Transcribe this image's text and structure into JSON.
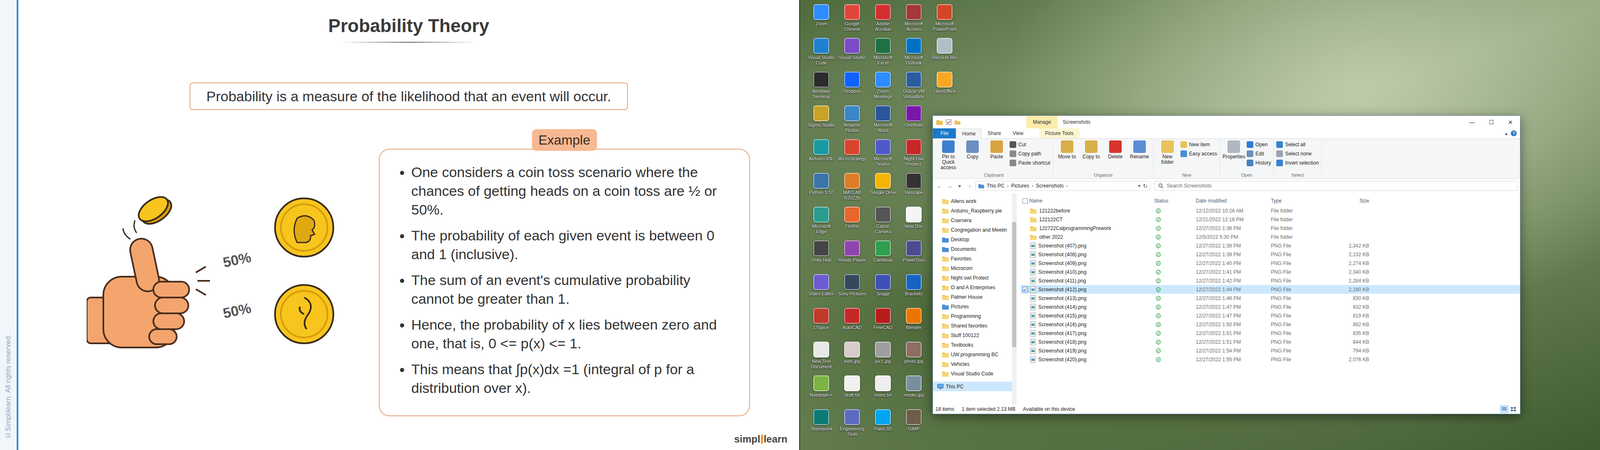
{
  "slide": {
    "title": "Probability Theory",
    "definition": "Probability is a measure of the likelihood that an event will occur.",
    "badge": "Example",
    "bullets": [
      "One considers a coin toss scenario where the chances of getting heads on a coin toss are ½ or 50%.",
      "The probability of each given event is between 0 and 1 (inclusive).",
      "The sum of an event's cumulative probability cannot be greater than 1.",
      "Hence, the probability of x lies between zero and one, that is, 0 <= p(x) <= 1.",
      "This means that ∫p(x)dx =1 (integral of p for a distribution over x)."
    ],
    "illustration_labels": [
      "50%",
      "50%"
    ],
    "copyright": "©Simplilearn. All rights reserved.",
    "logo": {
      "left": "simpl",
      "right": "learn"
    }
  },
  "desktop": {
    "icons": [
      {
        "label": "Zoom",
        "color": "#2d8cff"
      },
      {
        "label": "Visual Studio Code",
        "color": "#1f7fd0"
      },
      {
        "label": "Windows Terminal",
        "color": "#2b2b2b"
      },
      {
        "label": "Sigma Studio",
        "color": "#c9a227"
      },
      {
        "label": "Arduino IDE",
        "color": "#1a9aa0"
      },
      {
        "label": "Python 3.10",
        "color": "#3b74a8"
      },
      {
        "label": "Microsoft Edge",
        "color": "#2a9d8f"
      },
      {
        "label": "Unity Hub",
        "color": "#444444"
      },
      {
        "label": "Video Editor",
        "color": "#6b5bd1"
      },
      {
        "label": "LTspice",
        "color": "#c0392b"
      },
      {
        "label": "New Text Document",
        "color": "#e8e8e8"
      },
      {
        "label": "Notepad++",
        "color": "#7cb342"
      },
      {
        "label": "Sharepoint",
        "color": "#0b7a75"
      },
      {
        "label": "Google Chrome",
        "color": "#e0463a"
      },
      {
        "label": "Visual Studio",
        "color": "#7b4bc4"
      },
      {
        "label": "Dropbox",
        "color": "#0f62fe"
      },
      {
        "label": "Amazon Photos",
        "color": "#3a86c8"
      },
      {
        "label": "MicroStrategy",
        "color": "#d9442e"
      },
      {
        "label": "MATLAB R2022b",
        "color": "#e07b27"
      },
      {
        "label": "Firefox",
        "color": "#e8662b"
      },
      {
        "label": "Ready Player",
        "color": "#8e44ad"
      },
      {
        "label": "Sony Pictures",
        "color": "#34495e"
      },
      {
        "label": "AutoCAD",
        "color": "#c62828"
      },
      {
        "label": "todo.jpg",
        "color": "#d7ccc8"
      },
      {
        "label": "draft.txt",
        "color": "#f1f1f1"
      },
      {
        "label": "Engineering Tools",
        "color": "#5c6bc0"
      },
      {
        "label": "Adobe Acrobat",
        "color": "#d32f2f"
      },
      {
        "label": "Microsoft Excel",
        "color": "#1e7145"
      },
      {
        "label": "Zoom Meetings",
        "color": "#2d8cff"
      },
      {
        "label": "Microsoft Word",
        "color": "#2b579a"
      },
      {
        "label": "Microsoft Teams",
        "color": "#5059c9"
      },
      {
        "label": "Google Drive",
        "color": "#f4b400"
      },
      {
        "label": "Canon Camera",
        "color": "#555555"
      },
      {
        "label": "Camtasia",
        "color": "#2e9e4f"
      },
      {
        "label": "Snagit",
        "color": "#3f51b5"
      },
      {
        "label": "FreeCAD",
        "color": "#b71c1c"
      },
      {
        "label": "pic1.jpg",
        "color": "#9e9e9e"
      },
      {
        "label": "notes.txt",
        "color": "#eeeeee"
      },
      {
        "label": "Paint 3D",
        "color": "#00a4ef"
      },
      {
        "label": "Microsoft Access",
        "color": "#a4373a"
      },
      {
        "label": "Microsoft Outlook",
        "color": "#0072c6"
      },
      {
        "label": "Oracle VM VirtualBox",
        "color": "#2a5d9f"
      },
      {
        "label": "OneNote",
        "color": "#7719aa"
      },
      {
        "label": "Night Owl Protect",
        "color": "#c62828"
      },
      {
        "label": "Inkscape",
        "color": "#333333"
      },
      {
        "label": "New Doc",
        "color": "#f5f5f5"
      },
      {
        "label": "PowerToys",
        "color": "#4b4b8f"
      },
      {
        "label": "Brackets",
        "color": "#1565c0"
      },
      {
        "label": "Blender",
        "color": "#ea7600"
      },
      {
        "label": "photo.jpg",
        "color": "#8d6e63"
      },
      {
        "label": "render.jpg",
        "color": "#78909c"
      },
      {
        "label": "GIMP",
        "color": "#6d5d4b"
      },
      {
        "label": "Microsoft PowerPoint",
        "color": "#d24726"
      },
      {
        "label": "Recycle Bin",
        "color": "#b0bec5"
      },
      {
        "label": "LibreOffice",
        "color": "#f9a825"
      }
    ]
  },
  "explorer": {
    "title": "Screenshots",
    "context_tab": "Manage",
    "window_controls": [
      "—",
      "☐",
      "✕"
    ],
    "ribbon_tabs": [
      {
        "label": "File",
        "kind": "file",
        "selected": false
      },
      {
        "label": "Home",
        "kind": "normal",
        "selected": true
      },
      {
        "label": "Share",
        "kind": "normal",
        "selected": false
      },
      {
        "label": "View",
        "kind": "normal",
        "selected": false
      },
      {
        "label": "Picture Tools",
        "kind": "context",
        "selected": false
      }
    ],
    "ribbon_collapse": "▴",
    "help": "?",
    "ribbon_groups": [
      {
        "name": "Clipboard",
        "items": [
          {
            "label": "Pin to Quick access",
            "kind": "large",
            "color": "#3c7fd1"
          },
          {
            "label": "Copy",
            "kind": "large",
            "color": "#6a8fc0"
          },
          {
            "label": "Paste",
            "kind": "large",
            "color": "#d9a441"
          },
          {
            "label": "Cut",
            "kind": "small",
            "color": "#555555"
          },
          {
            "label": "Copy path",
            "kind": "small",
            "color": "#8a8a8a"
          },
          {
            "label": "Paste shortcut",
            "kind": "small",
            "color": "#8a8a8a"
          }
        ]
      },
      {
        "name": "Organize",
        "items": [
          {
            "label": "Move to",
            "kind": "large",
            "color": "#d8b04a"
          },
          {
            "label": "Copy to",
            "kind": "large",
            "color": "#d8b04a"
          },
          {
            "label": "Delete",
            "kind": "large",
            "color": "#d9342b"
          },
          {
            "label": "Rename",
            "kind": "large",
            "color": "#5b8dd6"
          }
        ]
      },
      {
        "name": "New",
        "items": [
          {
            "label": "New folder",
            "kind": "large",
            "color": "#e9c25c"
          },
          {
            "label": "New item",
            "kind": "small",
            "color": "#e9c25c"
          },
          {
            "label": "Easy access",
            "kind": "small",
            "color": "#4a8ed8"
          }
        ]
      },
      {
        "name": "Open",
        "items": [
          {
            "label": "Properties",
            "kind": "large",
            "color": "#b0b7c2"
          },
          {
            "label": "Open",
            "kind": "small",
            "color": "#2f7dd6"
          },
          {
            "label": "Edit",
            "kind": "small",
            "color": "#6b8fb8"
          },
          {
            "label": "History",
            "kind": "small",
            "color": "#4a7fc1"
          }
        ]
      },
      {
        "name": "Select",
        "items": [
          {
            "label": "Select all",
            "kind": "small",
            "color": "#3b83d1"
          },
          {
            "label": "Select none",
            "kind": "small",
            "color": "#9aa4b0"
          },
          {
            "label": "Invert selection",
            "kind": "small",
            "color": "#3b83d1"
          }
        ]
      }
    ],
    "nav_buttons": [
      "←",
      "→",
      "▾",
      "↑"
    ],
    "breadcrumb": [
      "This PC",
      "Pictures",
      "Screenshots"
    ],
    "separator": "›",
    "address_dropdown": "▾",
    "refresh": "↻",
    "search_placeholder": "Search Screenshots",
    "sidebar": [
      {
        "label": "Allens work",
        "kind": "folder",
        "selected": false
      },
      {
        "label": "Arduino_Raspberry pie",
        "kind": "folder",
        "selected": false
      },
      {
        "label": "Coarsera",
        "kind": "folder",
        "selected": false
      },
      {
        "label": "Congregation and Meetin",
        "kind": "folder",
        "selected": false
      },
      {
        "label": "Desktop",
        "kind": "special",
        "selected": false
      },
      {
        "label": "Documents",
        "kind": "special",
        "selected": false
      },
      {
        "label": "Favorites",
        "kind": "folder",
        "selected": false
      },
      {
        "label": "Microcom",
        "kind": "folder",
        "selected": false
      },
      {
        "label": "Night owl Protect",
        "kind": "folder",
        "selected": false
      },
      {
        "label": "O and A Enterprises",
        "kind": "folder",
        "selected": false
      },
      {
        "label": "Palmer House",
        "kind": "folder",
        "selected": false
      },
      {
        "label": "Pictures",
        "kind": "special",
        "selected": false
      },
      {
        "label": "Programming",
        "kind": "folder",
        "selected": false
      },
      {
        "label": "Shared favorites",
        "kind": "folder",
        "selected": false
      },
      {
        "label": "Stuff 100122",
        "kind": "folder",
        "selected": false
      },
      {
        "label": "Textbooks",
        "kind": "folder",
        "selected": false
      },
      {
        "label": "UW programming BC",
        "kind": "folder",
        "selected": false
      },
      {
        "label": "Vehicles",
        "kind": "folder",
        "selected": false
      },
      {
        "label": "Visual Studio Code",
        "kind": "folder",
        "selected": false
      },
      {
        "label": "This PC",
        "kind": "pc",
        "selected": true
      }
    ],
    "columns": [
      "Name",
      "Status",
      "Date modified",
      "Type",
      "Size"
    ],
    "rows": [
      {
        "name": "121222before",
        "date": "12/12/2022 10:26 AM",
        "type": "File folder",
        "size": "",
        "kind": "folder",
        "selected": false
      },
      {
        "name": "122122CT",
        "date": "12/21/2022 12:16 PM",
        "type": "File folder",
        "size": "",
        "kind": "folder",
        "selected": false
      },
      {
        "name": "122722CalprogrammingPrework",
        "date": "12/27/2022 1:36 PM",
        "type": "File folder",
        "size": "",
        "kind": "folder",
        "selected": false
      },
      {
        "name": "other 2022",
        "date": "12/5/2022 5:30 PM",
        "type": "File folder",
        "size": "",
        "kind": "folder",
        "selected": false
      },
      {
        "name": "Screenshot (407).png",
        "date": "12/27/2022 1:38 PM",
        "type": "PNG File",
        "size": "2,342 KB",
        "kind": "png",
        "selected": false
      },
      {
        "name": "Screenshot (408).png",
        "date": "12/27/2022 1:39 PM",
        "type": "PNG File",
        "size": "2,132 KB",
        "kind": "png",
        "selected": false
      },
      {
        "name": "Screenshot (409).png",
        "date": "12/27/2022 1:40 PM",
        "type": "PNG File",
        "size": "2,274 KB",
        "kind": "png",
        "selected": false
      },
      {
        "name": "Screenshot (410).png",
        "date": "12/27/2022 1:41 PM",
        "type": "PNG File",
        "size": "2,340 KB",
        "kind": "png",
        "selected": false
      },
      {
        "name": "Screenshot (411).png",
        "date": "12/27/2022 1:42 PM",
        "type": "PNG File",
        "size": "2,284 KB",
        "kind": "png",
        "selected": false
      },
      {
        "name": "Screenshot (412).png",
        "date": "12/27/2022 1:44 PM",
        "type": "PNG File",
        "size": "2,180 KB",
        "kind": "png",
        "selected": true
      },
      {
        "name": "Screenshot (413).png",
        "date": "12/27/2022 1:46 PM",
        "type": "PNG File",
        "size": "830 KB",
        "kind": "png",
        "selected": false
      },
      {
        "name": "Screenshot (414).png",
        "date": "12/27/2022 1:47 PM",
        "type": "PNG File",
        "size": "832 KB",
        "kind": "png",
        "selected": false
      },
      {
        "name": "Screenshot (415).png",
        "date": "12/27/2022 1:47 PM",
        "type": "PNG File",
        "size": "819 KB",
        "kind": "png",
        "selected": false
      },
      {
        "name": "Screenshot (416).png",
        "date": "12/27/2022 1:50 PM",
        "type": "PNG File",
        "size": "892 KB",
        "kind": "png",
        "selected": false
      },
      {
        "name": "Screenshot (417).png",
        "date": "12/27/2022 1:51 PM",
        "type": "PNG File",
        "size": "835 KB",
        "kind": "png",
        "selected": false
      },
      {
        "name": "Screenshot (418).png",
        "date": "12/27/2022 1:51 PM",
        "type": "PNG File",
        "size": "844 KB",
        "kind": "png",
        "selected": false
      },
      {
        "name": "Screenshot (419).png",
        "date": "12/27/2022 1:54 PM",
        "type": "PNG File",
        "size": "794 KB",
        "kind": "png",
        "selected": false
      },
      {
        "name": "Screenshot (420).png",
        "date": "12/27/2022 1:55 PM",
        "type": "PNG File",
        "size": "2,076 KB",
        "kind": "png",
        "selected": false
      }
    ],
    "status": [
      "18 items",
      "1 item selected  2.13 MB",
      "Available on this device"
    ],
    "view_buttons": [
      {
        "kind": "details",
        "selected": true
      },
      {
        "kind": "large-icons",
        "selected": false
      }
    ]
  }
}
